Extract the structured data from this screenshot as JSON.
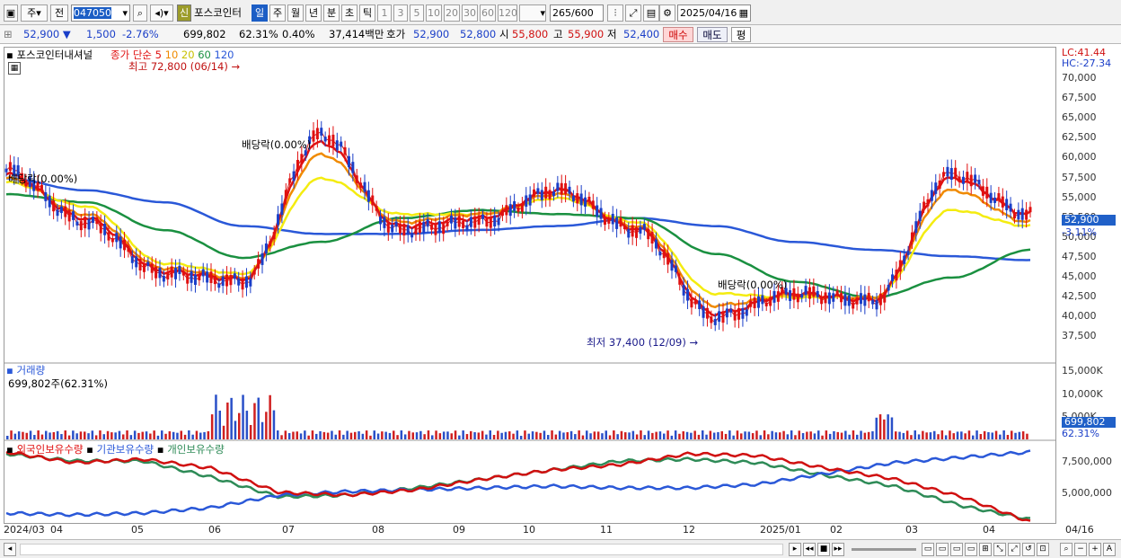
{
  "toolbar": {
    "mode_label": "주",
    "prev_label": "전",
    "code": "047050",
    "credit_badge": "신",
    "stock_name": "포스코인터",
    "period_tabs": [
      "일",
      "주",
      "월",
      "년",
      "분",
      "초",
      "틱"
    ],
    "interval_buttons": [
      "1",
      "3",
      "5",
      "10",
      "20",
      "30",
      "60",
      "120"
    ],
    "count_value": "265",
    "count_total": "/600",
    "date_value": "2025/04/16"
  },
  "quote": {
    "price": "52,900",
    "change": "1,500",
    "change_pct": "-2.76%",
    "volume": "699,802",
    "turnover_pct": "62.31%",
    "ratio": "0.40%",
    "amount": "37,414백만",
    "bid_label": "호가",
    "ask": "52,900",
    "bid": "52,800",
    "open_label": "시",
    "open": "55,800",
    "high_label": "고",
    "high": "55,900",
    "low_label": "저",
    "low": "52,400",
    "buy_label": "매수",
    "sell_label": "매도",
    "eval_label": "평"
  },
  "price_panel": {
    "name": "포스코인터내셔널",
    "ma_title": "종가 단순",
    "ma_periods": [
      "5",
      "10",
      "20",
      "60",
      "120"
    ],
    "ma_colors": [
      "#e01010",
      "#f08a00",
      "#f4ec10",
      "#1a9040",
      "#2a58d8"
    ],
    "max_note": "최고 72,800 (06/14)",
    "min_note": "최저 37,400 (12/09)",
    "div_notes": [
      "배당락(0.00%)",
      "배당락(0.00%)",
      "배당락(0.00%)"
    ],
    "lc": "LC:41.44",
    "hc": "HC:-27.34",
    "y_ticks": [
      "70,000",
      "67,500",
      "65,000",
      "62,500",
      "60,000",
      "57,500",
      "55,000",
      "52,500",
      "50,000",
      "47,500",
      "45,000",
      "42,500",
      "40,000",
      "37,500"
    ],
    "price_box": "52,900",
    "price_change": "-3.11%"
  },
  "volume_panel": {
    "title": "거래량",
    "value": "699,802주(62.31%)",
    "y_ticks": [
      "15,000K",
      "10,000K",
      "5,000K"
    ],
    "box_value": "699,802",
    "box_pct": "62.31%"
  },
  "holding_panel": {
    "legend": [
      "외국인보유수량",
      "기관보유수량",
      "개인보유수량"
    ],
    "colors": [
      "#e01010",
      "#2a58d8",
      "#2e8b57"
    ],
    "y_ticks": [
      "7,500,000",
      "5,000,000"
    ]
  },
  "x_labels": [
    "2024/03",
    "04",
    "05",
    "06",
    "07",
    "08",
    "09",
    "10",
    "11",
    "12",
    "2025/01",
    "02",
    "03",
    "04",
    "04/16"
  ],
  "chart_data": {
    "type": "line",
    "title": "포스코인터내셔널",
    "x": [
      "2024/03",
      "04",
      "05",
      "06",
      "07",
      "08",
      "09",
      "10",
      "11",
      "12",
      "2025/01",
      "02",
      "03",
      "04"
    ],
    "ylim": [
      35000,
      72800
    ],
    "series": [
      {
        "name": "종가",
        "values": [
          58500,
          52000,
          45500,
          44500,
          63000,
          51000,
          52000,
          56000,
          51000,
          40000,
          43000,
          42000,
          58000,
          52900
        ]
      },
      {
        "name": "5",
        "values": [
          58000,
          52500,
          45800,
          44800,
          62000,
          51500,
          52500,
          56000,
          51200,
          40500,
          43000,
          42200,
          57500,
          53000
        ]
      },
      {
        "name": "10",
        "values": [
          57500,
          53000,
          46200,
          45000,
          60500,
          52000,
          53000,
          55500,
          51500,
          41500,
          42800,
          42500,
          56000,
          52000
        ]
      },
      {
        "name": "20",
        "values": [
          57000,
          54000,
          46800,
          45500,
          57500,
          53000,
          53000,
          55000,
          52000,
          43000,
          42500,
          42500,
          53500,
          51500
        ]
      },
      {
        "name": "60",
        "values": [
          55500,
          54500,
          51000,
          47500,
          49500,
          52500,
          53500,
          53000,
          52500,
          48000,
          44500,
          42500,
          45000,
          48500
        ]
      },
      {
        "name": "120",
        "values": [
          57500,
          56000,
          54500,
          51500,
          50500,
          50500,
          51000,
          51500,
          52500,
          51500,
          49500,
          48500,
          47700,
          47200
        ]
      }
    ]
  }
}
